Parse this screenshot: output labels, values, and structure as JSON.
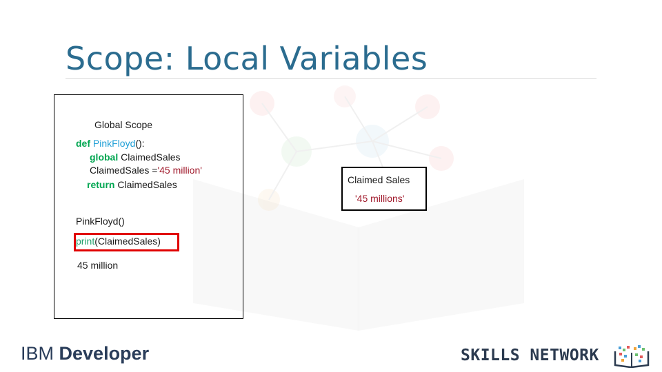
{
  "slide": {
    "title": "Scope: Local Variables"
  },
  "code_panel": {
    "heading": "Global Scope",
    "def_keyword": "def",
    "function_name": "PinkFloyd",
    "def_suffix": "():",
    "global_keyword": "global",
    "global_var": " ClaimedSales",
    "assign_prefix": "ClaimedSales =",
    "assign_value": "'45 million'",
    "return_keyword": "return",
    "return_var": " ClaimedSales",
    "call_line": "PinkFloyd()",
    "print_keyword": "print",
    "print_args": "(ClaimedSales)",
    "output": "45 million"
  },
  "variable_box": {
    "name": "Claimed Sales",
    "value": "'45 millions'"
  },
  "footer": {
    "ibm_prefix": "IBM ",
    "ibm_bold": "Developer",
    "skills_network": "SKILLS NETWORK"
  },
  "colors": {
    "title": "#2b6c8f",
    "keyword": "#00a651",
    "function": "#1f9fd6",
    "string": "#a0182a",
    "highlight": "#e00000"
  }
}
